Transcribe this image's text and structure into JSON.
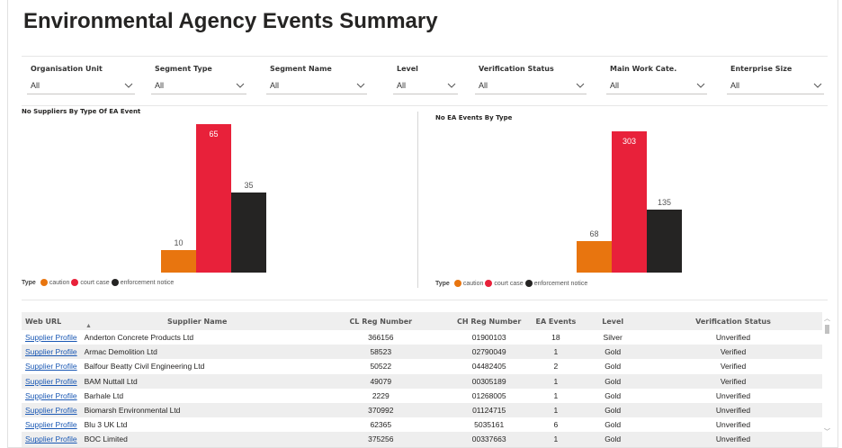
{
  "title": "Environmental Agency Events Summary",
  "filters": [
    {
      "label": "Organisation Unit",
      "value": "All"
    },
    {
      "label": "Segment Type",
      "value": "All"
    },
    {
      "label": "Segment Name",
      "value": "All"
    },
    {
      "label": "Level",
      "value": "All"
    },
    {
      "label": "Verification Status",
      "value": "All"
    },
    {
      "label": "Main Work Cate.",
      "value": "All"
    },
    {
      "label": "Enterprise Size",
      "value": "All"
    }
  ],
  "colors": {
    "caution": "#e8750f",
    "court_case": "#e8213a",
    "enforcement_notice": "#252423",
    "link": "#1a58b4"
  },
  "chart_data": [
    {
      "type": "bar",
      "title": "No Suppliers By Type Of EA Event",
      "categories": [
        "caution",
        "court case",
        "enforcement notice"
      ],
      "values": [
        10,
        65,
        35
      ],
      "legend_title": "Type",
      "legend_position": "bottom-left"
    },
    {
      "type": "bar",
      "title": "No EA Events By Type",
      "categories": [
        "caution",
        "court case",
        "enforcement notice"
      ],
      "values": [
        68,
        303,
        135
      ],
      "legend_title": "Type",
      "legend_position": "bottom-left"
    }
  ],
  "table": {
    "columns": [
      "Web URL",
      "Supplier Name",
      "CL Reg Number",
      "CH Reg Number",
      "EA Events",
      "Level",
      "Verification Status"
    ],
    "rows": [
      [
        "Supplier Profile",
        "Anderton Concrete Products Ltd",
        "366156",
        "01900103",
        "18",
        "Silver",
        "Unverified"
      ],
      [
        "Supplier Profile",
        "Armac Demolition Ltd",
        "58523",
        "02790049",
        "1",
        "Gold",
        "Verified"
      ],
      [
        "Supplier Profile",
        "Balfour Beatty Civil Engineering Ltd",
        "50522",
        "04482405",
        "2",
        "Gold",
        "Verified"
      ],
      [
        "Supplier Profile",
        "BAM Nuttall Ltd",
        "49079",
        "00305189",
        "1",
        "Gold",
        "Verified"
      ],
      [
        "Supplier Profile",
        "Barhale Ltd",
        "2229",
        "01268005",
        "1",
        "Gold",
        "Unverified"
      ],
      [
        "Supplier Profile",
        "Biomarsh Environmental Ltd",
        "370992",
        "01124715",
        "1",
        "Gold",
        "Unverified"
      ],
      [
        "Supplier Profile",
        "Blu 3 UK Ltd",
        "62365",
        "5035161",
        "6",
        "Gold",
        "Unverified"
      ],
      [
        "Supplier Profile",
        "BOC Limited",
        "375256",
        "00337663",
        "1",
        "Gold",
        "Unverified"
      ]
    ]
  }
}
